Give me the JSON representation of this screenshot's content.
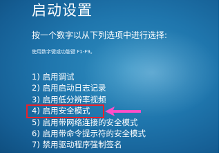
{
  "title": "启动设置",
  "prompt": "按一个数字以从下列选项中进行选择:",
  "hint": "使用数字键或功能键 F1-F9。",
  "options": [
    "1) 启用调试",
    "2) 启用启动日志记录",
    "3) 启用低分辨率视频",
    "4) 启用安全模式",
    "5) 启用带网络连接的安全模式",
    "6) 启用带命令提示符的安全模式",
    "7) 禁用驱动程序强制签名"
  ],
  "highlighted_option_index": 3,
  "colors": {
    "background": "#1f76ad",
    "highlight_box": "#e8222a",
    "arrow": "#ff4fc8"
  }
}
